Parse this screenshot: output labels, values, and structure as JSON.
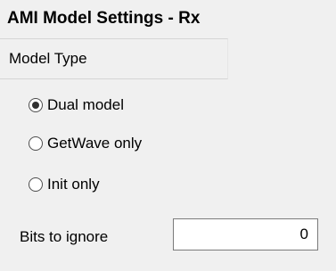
{
  "panel": {
    "title": "AMI Model Settings - Rx"
  },
  "model_type": {
    "label": "Model Type",
    "options": [
      {
        "label": "Dual model",
        "checked": true
      },
      {
        "label": "GetWave only",
        "checked": false
      },
      {
        "label": "Init only",
        "checked": false
      }
    ]
  },
  "bits_to_ignore": {
    "label": "Bits to ignore",
    "value": "0"
  }
}
